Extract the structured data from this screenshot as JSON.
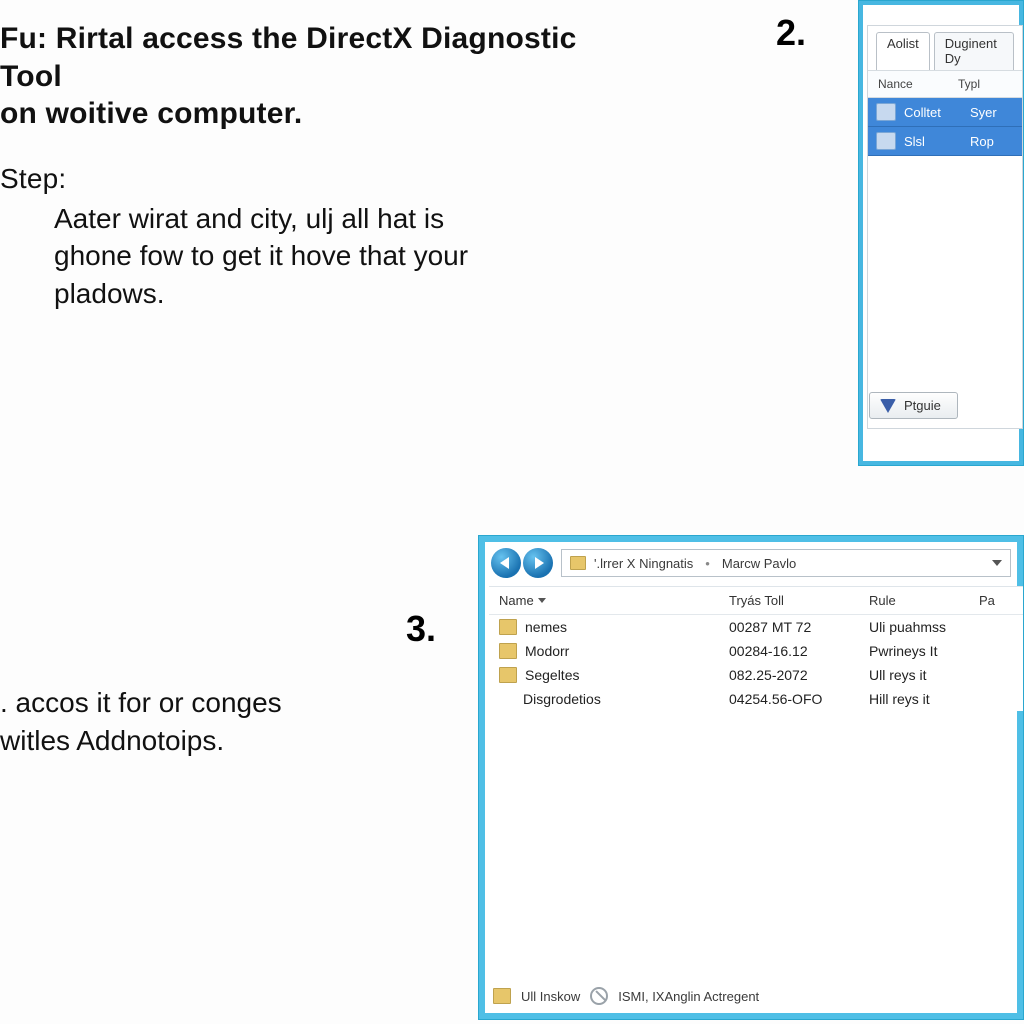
{
  "steps": {
    "s2_number": "2.",
    "s2_heading_l1": "Fu: Rirtal access the DirectX Diagnostic Tool",
    "s2_heading_l2": "on woitive computer.",
    "s2_step_label": "Step:",
    "s2_body_l1": "Aater wirat and city, ulj all hat is",
    "s2_body_l2": "ghone fow to get it hove that your",
    "s2_body_l3": "pladows.",
    "s3_number": "3.",
    "s3_body_l1": ". accos it for or conges",
    "s3_body_l2": "witles Addnotoips."
  },
  "win2": {
    "tab_active": "Aolist",
    "tab_other": "Duginent Dy",
    "col_name": "Nance",
    "col_type": "Typl",
    "row1_name": "Colltet",
    "row1_type": "Syer",
    "row2_name": "Slsl",
    "row2_type": "Rop",
    "btn_label": "Ptguie"
  },
  "win3": {
    "addr_seg1": "'.lrrer X Ningnatis",
    "addr_seg2": "Marcw Pavlo",
    "col_name": "Name",
    "col_type": "Tryás Toll",
    "col_rule": "Rule",
    "col_pa": "Pa",
    "rows": [
      {
        "name": "nemes",
        "type": "00287 MT 72",
        "rule": "Uli puahmss"
      },
      {
        "name": "Modorr",
        "type": "00284-16.12",
        "rule": "Pwrineys It"
      },
      {
        "name": "Segeltes",
        "type": "082.25-2072",
        "rule": "Ull reys it"
      },
      {
        "name": "Disgrodetios",
        "type": "04254.56-OFO",
        "rule": "Hill reys it"
      }
    ],
    "status_left": "Ull Inskow",
    "status_right": "ISMI, IXAnglin Actregent"
  }
}
